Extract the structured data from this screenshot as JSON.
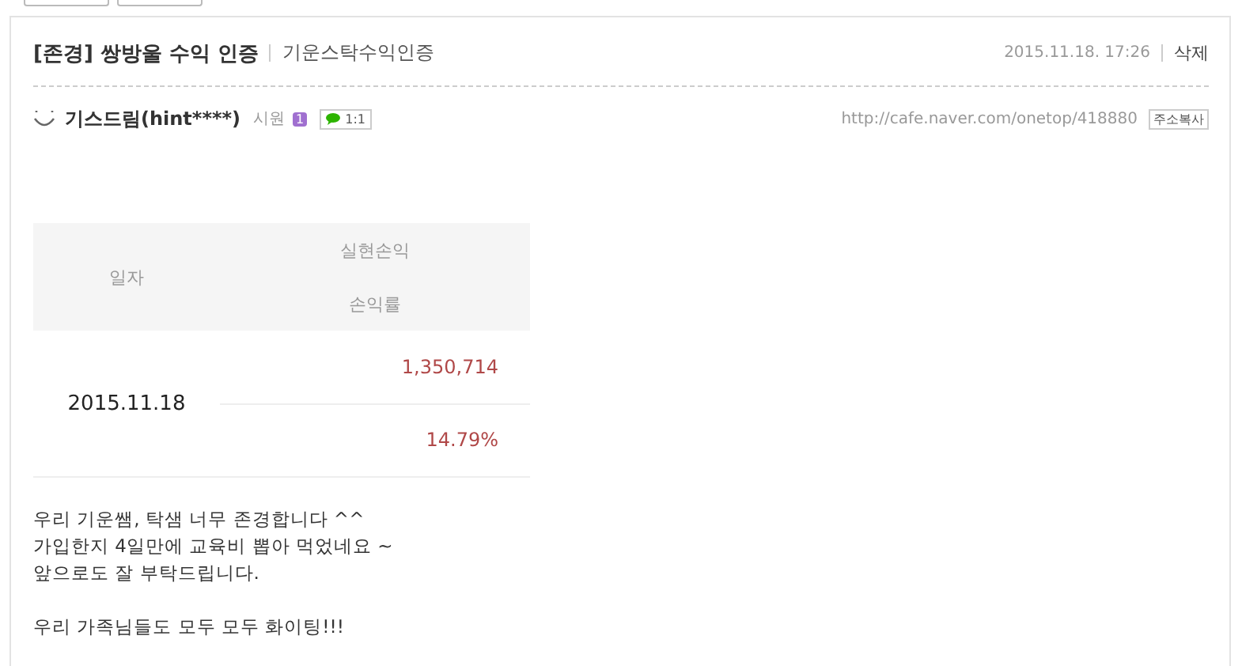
{
  "post": {
    "title": "[존경] 쌍방울 수익 인증",
    "category": "기운스탁수익인증",
    "date": "2015.11.18. 17:26",
    "delete": "삭제"
  },
  "author": {
    "nickname": "기스드림(hint****)",
    "rank": "시원",
    "level_badge": "1",
    "chat": "1:1",
    "url": "http://cafe.naver.com/onetop/418880",
    "copy": "주소복사"
  },
  "table": {
    "headers": [
      "일자",
      "실현손익",
      "손익률"
    ],
    "date": "2015.11.18",
    "profit": "1,350,714",
    "rate": "14.79%"
  },
  "body": [
    [
      "우리 기운쌤, 탁샘 너무 존경합니다 ^^",
      "가입한지 4일만에 교육비 뽑아 먹었네요 ~",
      "앞으로도 잘 부탁드립니다."
    ],
    [
      "우리 가족님들도 모두 모두 화이팅!!!"
    ]
  ]
}
